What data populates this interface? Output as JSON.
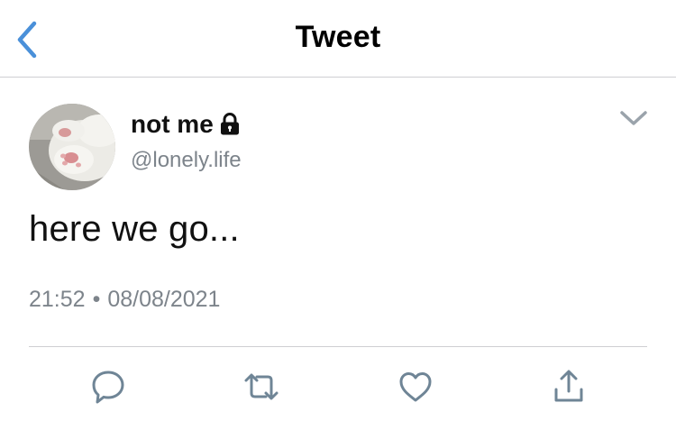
{
  "header": {
    "title": "Tweet",
    "back_icon": "chevron-left-icon",
    "accent_color": "#4a90d9"
  },
  "tweet": {
    "author": {
      "display_name": "not me",
      "handle": "@lonely.life",
      "protected_icon": "lock-icon"
    },
    "text": "here we go...",
    "time": "21:52",
    "separator": "•",
    "date": "08/08/2021",
    "menu_icon": "chevron-down-icon"
  },
  "actions": [
    {
      "name": "reply",
      "icon": "reply-icon"
    },
    {
      "name": "retweet",
      "icon": "retweet-icon"
    },
    {
      "name": "like",
      "icon": "heart-icon"
    },
    {
      "name": "share",
      "icon": "share-icon"
    }
  ],
  "colors": {
    "muted": "#7d848b",
    "action_icons": "#6f8596",
    "divider": "#cfcfd2"
  }
}
